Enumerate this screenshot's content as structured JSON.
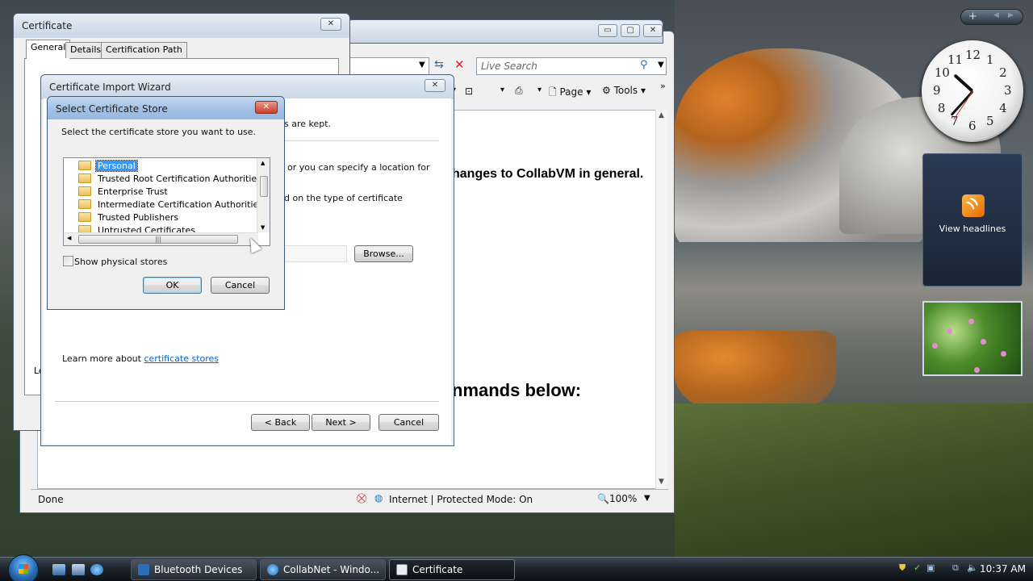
{
  "ie": {
    "search_placeholder": "Live Search",
    "cmd_page": "Page",
    "cmd_tools": "Tools",
    "content_line1": "hanges to CollabVM in general.",
    "content_line2": "nmands below:",
    "status_done": "Done",
    "status_zone": "Internet | Protected Mode: On",
    "zoom": "100%"
  },
  "cert": {
    "title": "Certificate",
    "tabs": [
      "General",
      "Details",
      "Certification Path"
    ],
    "truncated_label": "Le"
  },
  "wizard": {
    "title": "Certificate Import Wizard",
    "text1": "s are kept.",
    "text2": "or you can specify a location for",
    "text3": "d on the type of certificate",
    "browse": "Browse...",
    "learn_more": "Learn more about",
    "learn_link": "certificate stores",
    "back": "< Back",
    "next": "Next >",
    "cancel": "Cancel"
  },
  "store_dialog": {
    "title": "Select Certificate Store",
    "prompt": "Select the certificate store you want to use.",
    "items": [
      "Personal",
      "Trusted Root Certification Authorities",
      "Enterprise Trust",
      "Intermediate Certification Authorities",
      "Trusted Publishers",
      "Untrusted Certificates"
    ],
    "selected_index": 0,
    "show_physical": "Show physical stores",
    "ok": "OK",
    "cancel": "Cancel"
  },
  "gadgets": {
    "feed_label": "View headlines",
    "clock_numbers": [
      "12",
      "1",
      "2",
      "3",
      "4",
      "5",
      "6",
      "7",
      "8",
      "9",
      "10",
      "11"
    ]
  },
  "taskbar": {
    "tasks": [
      {
        "label": "Bluetooth Devices",
        "active": false
      },
      {
        "label": "CollabNet - Windo...",
        "active": false
      },
      {
        "label": "Certificate",
        "active": true
      }
    ],
    "time": "10:37 AM"
  },
  "colors": {
    "selection": "#3399ff",
    "link": "#0b62c4"
  }
}
